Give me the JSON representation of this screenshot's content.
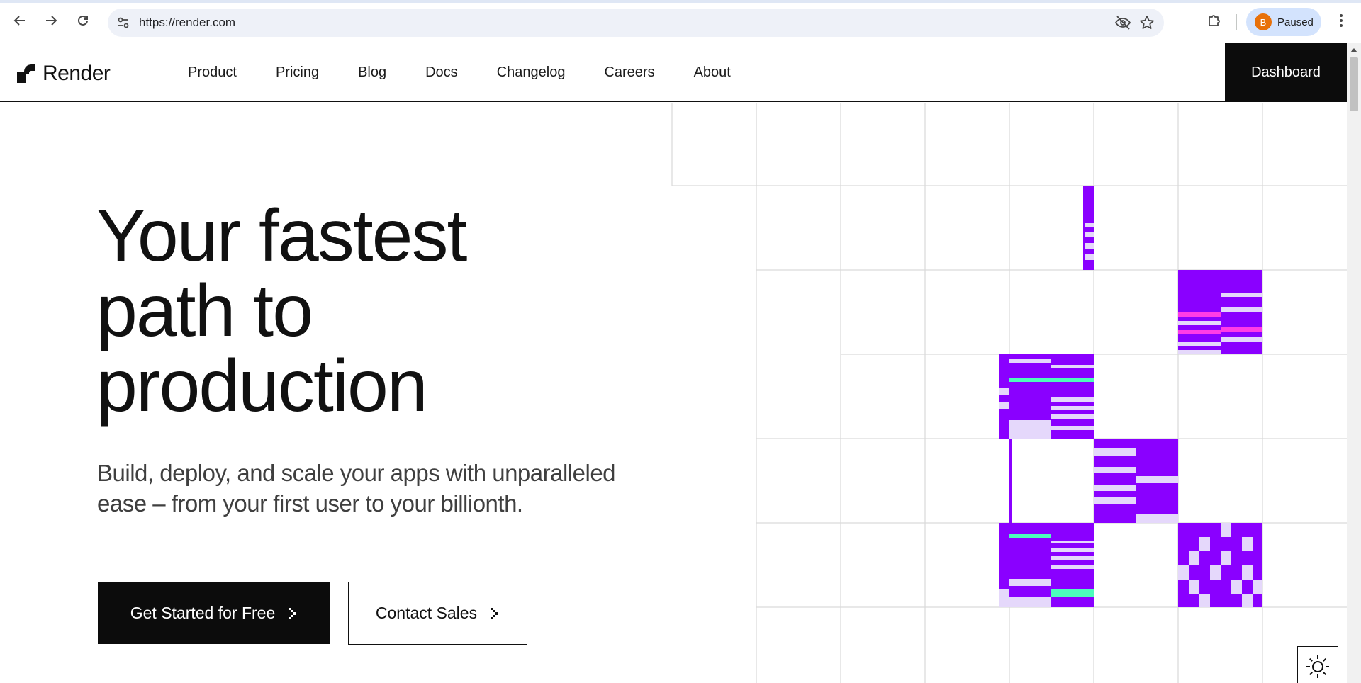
{
  "browser": {
    "url": "https://render.com",
    "profile_initial": "B",
    "profile_status": "Paused"
  },
  "header": {
    "logo_text": "Render",
    "nav": [
      "Product",
      "Pricing",
      "Blog",
      "Docs",
      "Changelog",
      "Careers",
      "About"
    ],
    "dashboard_label": "Dashboard"
  },
  "hero": {
    "title_lines": [
      "Your fastest",
      "path to",
      "production"
    ],
    "subtitle_lines": [
      "Build, deploy, and scale your apps with unparalleled",
      "ease – from your first user to your billionth."
    ],
    "primary_cta": "Get Started for Free",
    "secondary_cta": "Contact Sales"
  },
  "colors": {
    "brand_purple": "#8a00ff",
    "accent_pink": "#ff3ce6",
    "accent_green": "#4dfcbc",
    "light_lavender": "#e5d8fb",
    "ink": "#0c0c0c"
  },
  "icons": {
    "back": "arrow-left-icon",
    "forward": "arrow-right-icon",
    "reload": "reload-icon",
    "site_info": "tune-icon",
    "hidden": "eye-off-icon",
    "bookmark": "star-icon",
    "extensions": "puzzle-icon",
    "menu": "kebab-menu-icon",
    "theme": "sun-icon"
  }
}
